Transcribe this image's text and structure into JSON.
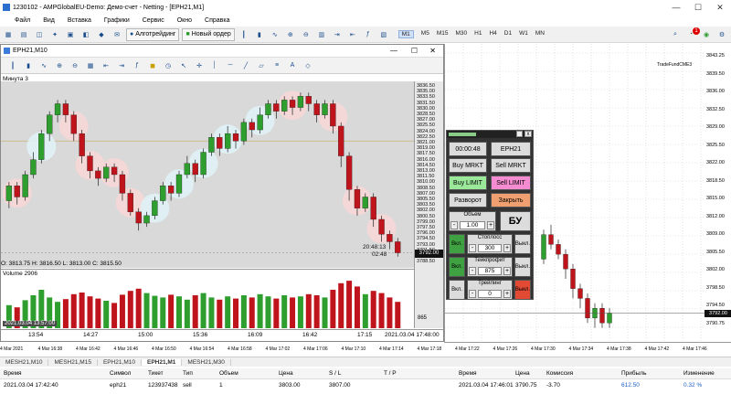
{
  "window": {
    "title": "1230102 - AMPGlobalEU-Demo: Демо-счет - Netting - [EPH21,M1]"
  },
  "menu": [
    "Файл",
    "Вид",
    "Вставка",
    "Графики",
    "Сервис",
    "Окно",
    "Справка"
  ],
  "toolbar": {
    "algo_label": "Алготрейдинг",
    "new_order_label": "Новый ордер",
    "timeframes": [
      "M1",
      "M5",
      "M15",
      "M30",
      "H1",
      "H4",
      "D1",
      "W1",
      "MN"
    ],
    "selected_tf": "M1",
    "badge": "1"
  },
  "inner_chart": {
    "title": "EPH21,M10",
    "minute_label": "Минута  3",
    "ohlc": "O: 3813.75  H: 3816.50  L: 3813.00  C: 3815.50",
    "volume_label": "Volume 2906",
    "date_stamp": "2021.03.04 13:57:00",
    "date_right": "2021.03.04 17:48:00",
    "price_current": "3792.00",
    "timer1": "20:48:13",
    "timer2": "02:48",
    "vol_scale": "865",
    "price_labels": [
      "3836.50",
      "3835.00",
      "3833.50",
      "3831.50",
      "3830.00",
      "3828.50",
      "3827.00",
      "3825.50",
      "3824.00",
      "3822.50",
      "3821.00",
      "3819.00",
      "3817.50",
      "3816.00",
      "3814.50",
      "3813.00",
      "3811.50",
      "3810.00",
      "3808.50",
      "3807.00",
      "3805.50",
      "3803.50",
      "3802.00",
      "3800.50",
      "3799.00",
      "3797.50",
      "3796.00",
      "3794.50",
      "3793.00",
      "3791.50",
      "3790.00",
      "3788.50"
    ],
    "time_labels": [
      "13:54",
      "14:27",
      "15:00",
      "15:36",
      "16:09",
      "16:42",
      "17:15"
    ],
    "candles": [
      {
        "o": 3806,
        "c": 3810,
        "h": 3811,
        "l": 3804
      },
      {
        "o": 3810,
        "c": 3807,
        "h": 3811,
        "l": 3805
      },
      {
        "o": 3807,
        "c": 3813,
        "h": 3814,
        "l": 3806
      },
      {
        "o": 3813,
        "c": 3817,
        "h": 3819,
        "l": 3812
      },
      {
        "o": 3817,
        "c": 3824,
        "h": 3825,
        "l": 3816
      },
      {
        "o": 3824,
        "c": 3829,
        "h": 3830,
        "l": 3822
      },
      {
        "o": 3829,
        "c": 3832,
        "h": 3833,
        "l": 3827
      },
      {
        "o": 3832,
        "c": 3829,
        "h": 3833,
        "l": 3827
      },
      {
        "o": 3829,
        "c": 3824,
        "h": 3830,
        "l": 3822
      },
      {
        "o": 3824,
        "c": 3818,
        "h": 3825,
        "l": 3816
      },
      {
        "o": 3818,
        "c": 3814,
        "h": 3819,
        "l": 3812
      },
      {
        "o": 3814,
        "c": 3812,
        "h": 3815,
        "l": 3810
      },
      {
        "o": 3812,
        "c": 3815,
        "h": 3816,
        "l": 3811
      },
      {
        "o": 3815,
        "c": 3813,
        "h": 3816,
        "l": 3811
      },
      {
        "o": 3813,
        "c": 3808,
        "h": 3814,
        "l": 3806
      },
      {
        "o": 3808,
        "c": 3803,
        "h": 3809,
        "l": 3802
      },
      {
        "o": 3803,
        "c": 3800,
        "h": 3804,
        "l": 3798
      },
      {
        "o": 3800,
        "c": 3802,
        "h": 3803,
        "l": 3799
      },
      {
        "o": 3802,
        "c": 3806,
        "h": 3807,
        "l": 3801
      },
      {
        "o": 3806,
        "c": 3810,
        "h": 3811,
        "l": 3805
      },
      {
        "o": 3810,
        "c": 3808,
        "h": 3811,
        "l": 3806
      },
      {
        "o": 3808,
        "c": 3813,
        "h": 3814,
        "l": 3807
      },
      {
        "o": 3813,
        "c": 3816,
        "h": 3818,
        "l": 3812
      },
      {
        "o": 3816,
        "c": 3813,
        "h": 3817,
        "l": 3811
      },
      {
        "o": 3813,
        "c": 3819,
        "h": 3820,
        "l": 3812
      },
      {
        "o": 3819,
        "c": 3823,
        "h": 3824,
        "l": 3818
      },
      {
        "o": 3823,
        "c": 3820,
        "h": 3824,
        "l": 3818
      },
      {
        "o": 3820,
        "c": 3824,
        "h": 3826,
        "l": 3819
      },
      {
        "o": 3824,
        "c": 3822,
        "h": 3825,
        "l": 3820
      },
      {
        "o": 3822,
        "c": 3827,
        "h": 3828,
        "l": 3821
      },
      {
        "o": 3827,
        "c": 3825,
        "h": 3828,
        "l": 3823
      },
      {
        "o": 3825,
        "c": 3829,
        "h": 3831,
        "l": 3824
      },
      {
        "o": 3829,
        "c": 3832,
        "h": 3833,
        "l": 3828
      },
      {
        "o": 3832,
        "c": 3830,
        "h": 3833,
        "l": 3828
      },
      {
        "o": 3830,
        "c": 3833,
        "h": 3834,
        "l": 3829
      },
      {
        "o": 3833,
        "c": 3831,
        "h": 3834,
        "l": 3829
      },
      {
        "o": 3831,
        "c": 3834,
        "h": 3835,
        "l": 3830
      },
      {
        "o": 3834,
        "c": 3832,
        "h": 3835,
        "l": 3830
      },
      {
        "o": 3832,
        "c": 3829,
        "h": 3833,
        "l": 3827
      },
      {
        "o": 3829,
        "c": 3832,
        "h": 3833,
        "l": 3828
      },
      {
        "o": 3832,
        "c": 3826,
        "h": 3833,
        "l": 3824
      },
      {
        "o": 3826,
        "c": 3818,
        "h": 3827,
        "l": 3815
      },
      {
        "o": 3818,
        "c": 3809,
        "h": 3819,
        "l": 3806
      },
      {
        "o": 3809,
        "c": 3804,
        "h": 3810,
        "l": 3802
      },
      {
        "o": 3804,
        "c": 3807,
        "h": 3808,
        "l": 3803
      },
      {
        "o": 3807,
        "c": 3801,
        "h": 3808,
        "l": 3799
      },
      {
        "o": 3801,
        "c": 3797,
        "h": 3802,
        "l": 3795
      },
      {
        "o": 3797,
        "c": 3795,
        "h": 3798,
        "l": 3793
      },
      {
        "o": 3795,
        "c": 3792,
        "h": 3796,
        "l": 3791
      }
    ],
    "volumes": [
      420,
      380,
      510,
      600,
      700,
      560,
      480,
      530,
      620,
      650,
      580,
      540,
      500,
      460,
      610,
      680,
      720,
      640,
      590,
      560,
      610,
      580,
      520,
      600,
      640,
      560,
      520,
      580,
      540,
      600,
      560,
      620,
      580,
      540,
      600,
      560,
      580,
      620,
      600,
      560,
      700,
      820,
      865,
      760,
      620,
      680,
      640,
      560,
      480
    ]
  },
  "main_chart": {
    "price_labels": [
      "3843.25",
      "3839.50",
      "3836.00",
      "3832.50",
      "3829.00",
      "3825.50",
      "3822.00",
      "3818.50",
      "3815.00",
      "3812.00",
      "3809.00",
      "3805.50",
      "3802.00",
      "3798.50",
      "3794.50",
      "3790.75"
    ],
    "current_price": "3792.00",
    "brand": "TradeFundCME3",
    "time_labels": [
      "4 Mar 2021",
      "4 Mar 16:38",
      "4 Mar 16:42",
      "4 Mar 16:46",
      "4 Mar 16:50",
      "4 Mar 16:54",
      "4 Mar 16:58",
      "4 Mar 17:02",
      "4 Mar 17:06",
      "4 Mar 17:10",
      "4 Mar 17:14",
      "4 Mar 17:18",
      "4 Mar 17:22",
      "4 Mar 17:26",
      "4 Mar 17:30",
      "4 Mar 17:34",
      "4 Mar 17:38",
      "4 Mar 17:42",
      "4 Mar 17:46"
    ],
    "candles": [
      {
        "o": 3803,
        "c": 3808,
        "h": 3809,
        "l": 3802
      },
      {
        "o": 3808,
        "c": 3806,
        "h": 3810,
        "l": 3805
      },
      {
        "o": 3806,
        "c": 3804,
        "h": 3807,
        "l": 3803
      },
      {
        "o": 3804,
        "c": 3801,
        "h": 3805,
        "l": 3799
      },
      {
        "o": 3801,
        "c": 3797,
        "h": 3802,
        "l": 3795
      },
      {
        "o": 3797,
        "c": 3795,
        "h": 3798,
        "l": 3793
      },
      {
        "o": 3795,
        "c": 3791,
        "h": 3796,
        "l": 3790
      },
      {
        "o": 3791,
        "c": 3793,
        "h": 3794,
        "l": 3789
      },
      {
        "o": 3793,
        "c": 3790,
        "h": 3794,
        "l": 3789
      },
      {
        "o": 3790,
        "c": 3792,
        "h": 3793,
        "l": 3789
      }
    ]
  },
  "panel": {
    "timer": "00:00:48",
    "symbol": "EPH21",
    "buy_mrkt": "Buy MRKT",
    "sell_mrkt": "Sell MRKT",
    "buy_limit": "Buy LIMIT",
    "sell_limit": "Sell LIMIT",
    "reverse": "Разворот",
    "close": "Закрыть",
    "volume_label": "Объем",
    "volume": "1.00",
    "order_type": "БУ",
    "stoploss_label": "Стоплосс",
    "stoploss": "300",
    "takeprofit_label": "Тейкпрофит",
    "takeprofit": "875",
    "trailing_label": "Трейлинг",
    "trailing": "0",
    "on": "Вкл.",
    "off": "Выкл.",
    "minus": "-",
    "plus": "+"
  },
  "bottom_tabs": [
    "MESH21,M10",
    "MESH21,M15",
    "EPH21,M10",
    "EPH21,M1",
    "MESH21,M30"
  ],
  "active_tab": "EPH21,M1",
  "trade_columns": [
    "Время",
    "Символ",
    "Тикет",
    "Тип",
    "Объем",
    "Цена",
    "S / L",
    "T / P",
    "Время",
    "Цена",
    "Комиссия",
    "Прибыль",
    "Изменение"
  ],
  "trade_row": [
    "2021.03.04 17:42:40",
    "eph21",
    "123937438",
    "sell",
    "1",
    "3803.00",
    "3807.00",
    "",
    "2021.03.04 17:46:01",
    "3790.75",
    "-3.70",
    "612.50",
    "0.32 %"
  ],
  "colors": {
    "bull": "#2e9e2e",
    "bear": "#c0141c",
    "panel_green": "#3fa142",
    "panel_red": "#e24a33",
    "buy_btn": "#9be89b",
    "sell_btn": "#f58bd0",
    "close_btn": "#f0a070"
  }
}
